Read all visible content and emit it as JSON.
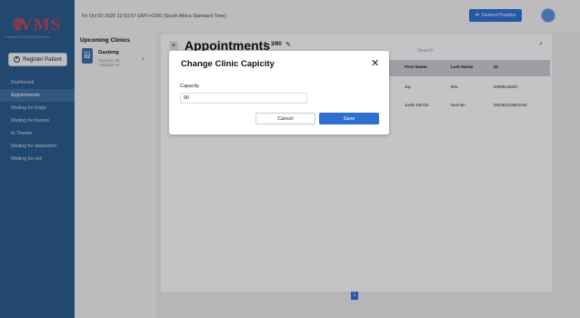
{
  "brand": {
    "logo_text": "VMS",
    "tagline": "Facilities VMS Blade Ambulatories"
  },
  "sidebar": {
    "register_label": "Register Patient",
    "items": [
      {
        "label": "Dashboard",
        "active": false
      },
      {
        "label": "Appointments",
        "active": true
      },
      {
        "label": "Waiting for triage",
        "active": false
      },
      {
        "label": "Waiting for theatre",
        "active": false
      },
      {
        "label": "In Theatre",
        "active": false
      },
      {
        "label": "Waiting for disposition",
        "active": false
      },
      {
        "label": "Waiting for exit",
        "active": false
      }
    ]
  },
  "topbar": {
    "datetime": "Fri Oct 02 2020 12:03:57 GMT+0200 (South Africa Standard Time)",
    "practice_label": "General Practice",
    "practice_icon": "shuffle-icon"
  },
  "clinics": {
    "title": "Upcoming Clinics",
    "items": [
      {
        "month": "OCT",
        "day": "02",
        "name": "Gauteng",
        "capacity": "Capacity: 90",
        "available": "Available: 87"
      }
    ]
  },
  "main": {
    "title": "Appointments",
    "count": "3/90",
    "search_placeholder": "Search",
    "table": {
      "columns": [
        "First Name",
        "Last Name",
        "ID"
      ],
      "rows": [
        [
          "Jay",
          "Rav",
          "92090145337"
        ],
        [
          "Justin Derrick",
          "Norman",
          "062381234801234"
        ]
      ]
    },
    "current_page": "1"
  },
  "modal": {
    "title": "Change Clinic Capicity",
    "close_glyph": "✕",
    "capacity_label": "Capacity",
    "capacity_value": "90",
    "cancel_label": "Cancel",
    "save_label": "Save"
  },
  "colors": {
    "sidebar": "#2c5b8b",
    "accent": "#2f6fd0",
    "logo": "#b7495a"
  }
}
